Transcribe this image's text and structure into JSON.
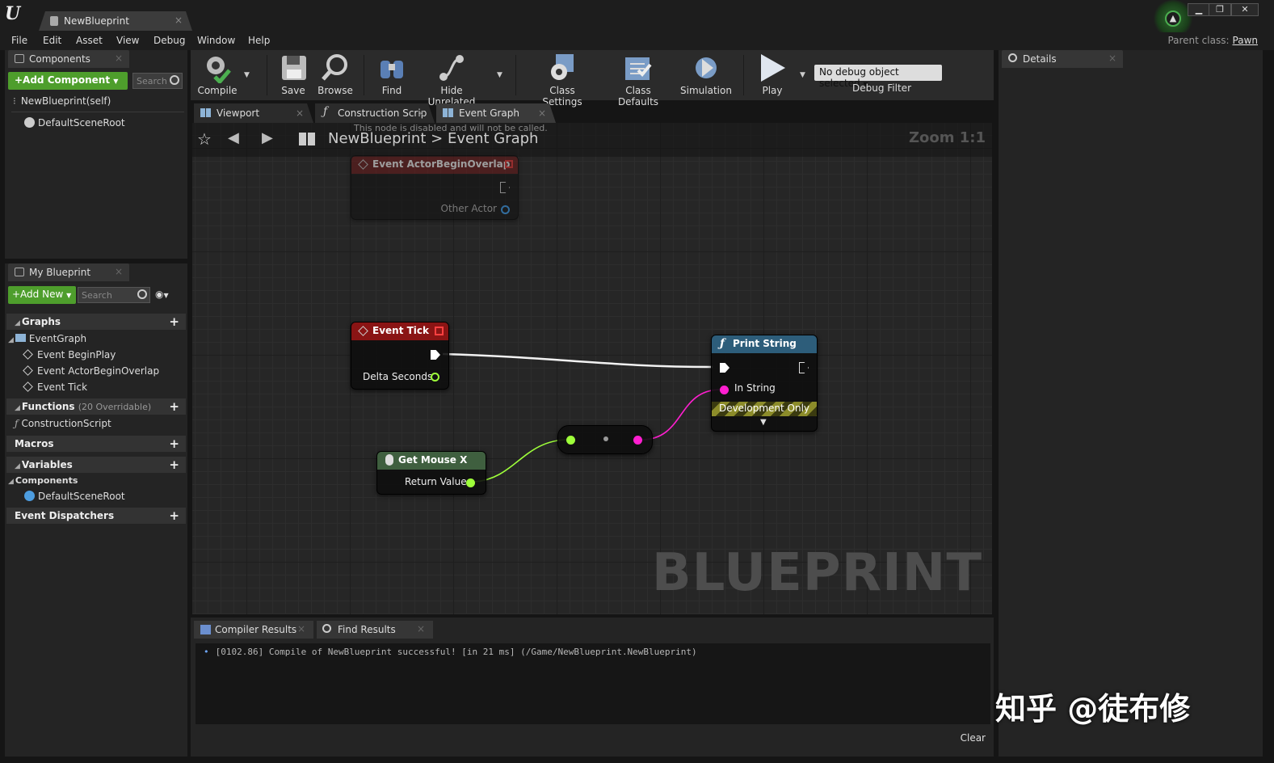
{
  "window": {
    "tab_title": "NewBlueprint",
    "parent_class_label": "Parent class:",
    "parent_class_value": "Pawn",
    "btn_minimize": "▁",
    "btn_restore": "❐",
    "btn_close": "✕"
  },
  "menu": [
    "File",
    "Edit",
    "Asset",
    "View",
    "Debug",
    "Window",
    "Help"
  ],
  "components_panel": {
    "tab": "Components",
    "add_button": "+Add Component",
    "search_placeholder": "Search",
    "items": [
      "NewBlueprint(self)",
      "DefaultSceneRoot"
    ]
  },
  "my_blueprint_panel": {
    "tab": "My Blueprint",
    "add_button": "+Add New",
    "search_placeholder": "Search",
    "graphs_header": "Graphs",
    "event_graph": "EventGraph",
    "events": [
      "Event BeginPlay",
      "Event ActorBeginOverlap",
      "Event Tick"
    ],
    "functions_header": "Functions",
    "functions_hint": "(20 Overridable)",
    "construction_script": "ConstructionScript",
    "macros_header": "Macros",
    "variables_header": "Variables",
    "components_header": "Components",
    "component_item": "DefaultSceneRoot",
    "dispatchers_header": "Event Dispatchers"
  },
  "toolbar": {
    "compile": "Compile",
    "save": "Save",
    "browse": "Browse",
    "find": "Find",
    "hide_unrelated": "Hide Unrelated",
    "class_settings": "Class Settings",
    "class_defaults": "Class Defaults",
    "simulation": "Simulation",
    "play": "Play",
    "debug_select": "No debug object selected",
    "debug_filter": "Debug Filter"
  },
  "editor_tabs": [
    "Viewport",
    "Construction Scrip",
    "Event Graph"
  ],
  "graph": {
    "breadcrumb_root": "NewBlueprint",
    "breadcrumb_sep": ">",
    "breadcrumb_current": "Event Graph",
    "zoom": "Zoom 1:1",
    "disabled_note": "This node is disabled and will not be called.",
    "watermark": "BLUEPRINT",
    "nodes": {
      "overlap": {
        "title": "Event ActorBeginOverlap",
        "pin": "Other Actor"
      },
      "tick": {
        "title": "Event Tick",
        "pin": "Delta Seconds"
      },
      "print": {
        "title": "Print String",
        "pin": "In String",
        "footer": "Development Only"
      },
      "mouse": {
        "title": "Get Mouse X",
        "pin": "Return Value"
      }
    },
    "colors": {
      "event_header": "#8a1414",
      "function_header": "#2d5d7a",
      "pure_header": "#3f5f3f",
      "float_pin": "#9eff3a",
      "string_pin": "#ff1fd0"
    }
  },
  "details_panel": {
    "tab": "Details"
  },
  "bottom_panel": {
    "tabs": [
      "Compiler Results",
      "Find Results"
    ],
    "log": "[0102.86] Compile of NewBlueprint successful! [in 21 ms] (/Game/NewBlueprint.NewBlueprint)",
    "clear": "Clear"
  },
  "watermark": "知乎 @徒布修"
}
